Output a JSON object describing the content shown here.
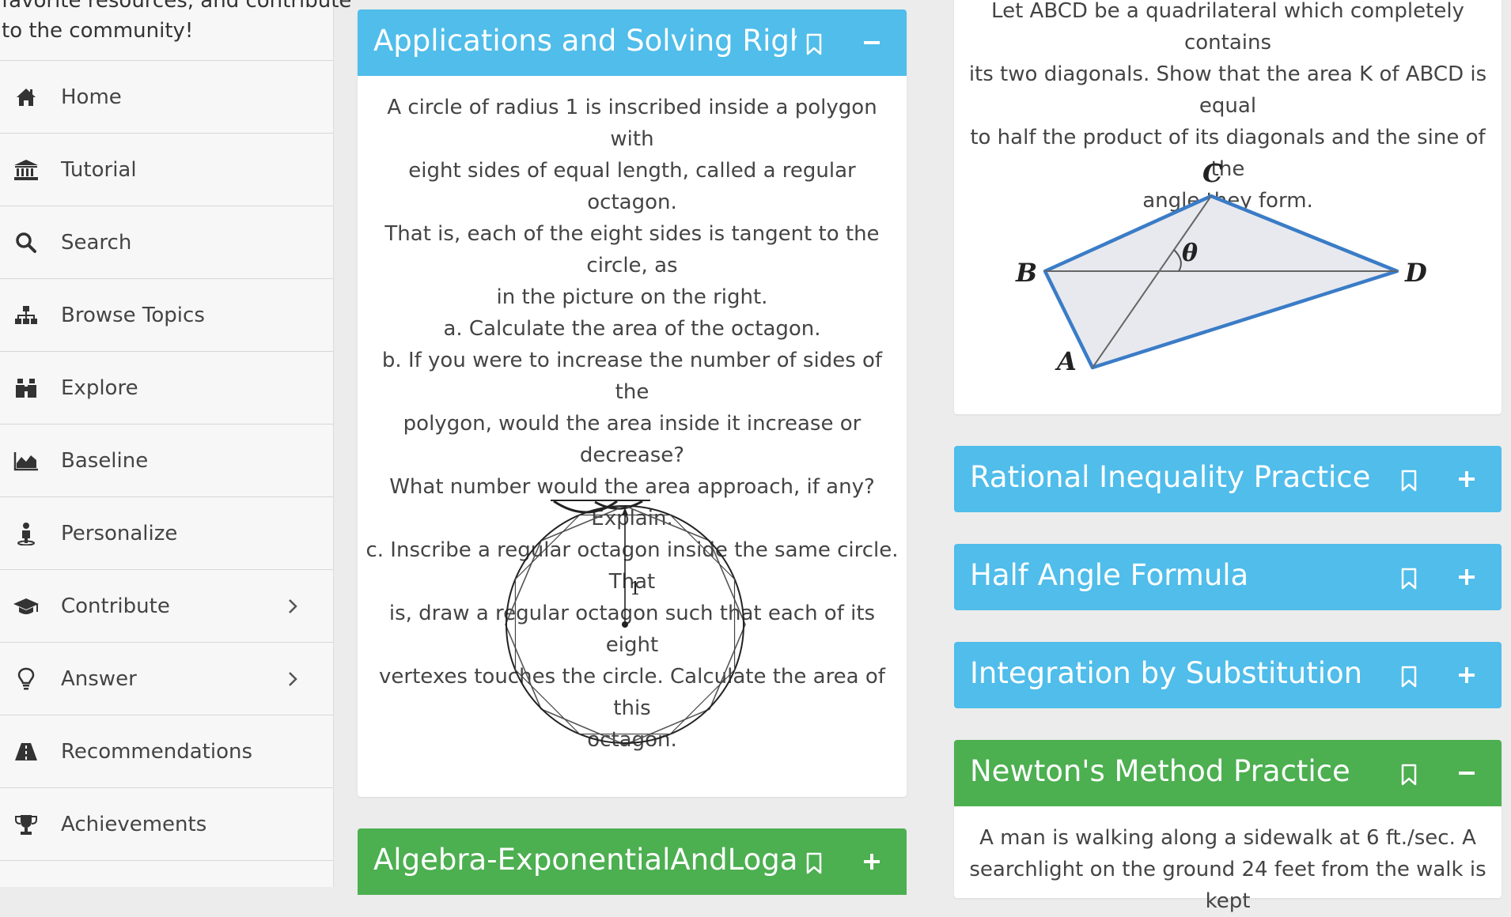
{
  "sidebar": {
    "intro_line1": "favorite resources, and contribute",
    "intro_line2": "to the community!",
    "items": [
      {
        "label": "Home",
        "icon": "home-icon"
      },
      {
        "label": "Tutorial",
        "icon": "institution-icon"
      },
      {
        "label": "Search",
        "icon": "search-icon"
      },
      {
        "label": "Browse Topics",
        "icon": "sitemap-icon"
      },
      {
        "label": "Explore",
        "icon": "binoculars-icon"
      },
      {
        "label": "Baseline",
        "icon": "area-chart-icon"
      },
      {
        "label": "Personalize",
        "icon": "person-icon"
      },
      {
        "label": "Contribute",
        "icon": "graduation-cap-icon",
        "has_submenu": true
      },
      {
        "label": "Answer",
        "icon": "lightbulb-icon",
        "has_submenu": true
      },
      {
        "label": "Recommendations",
        "icon": "road-icon"
      },
      {
        "label": "Achievements",
        "icon": "trophy-icon"
      }
    ]
  },
  "colors": {
    "blue_header": "#50bdea",
    "green_header": "#4caf50",
    "sidebar_bg": "#f7f7f7",
    "page_bg": "#ececec"
  },
  "cards": {
    "applications": {
      "title": "Applications and Solving Right Triangles",
      "lines": [
        "A circle of radius 1 is inscribed inside a polygon with",
        "eight sides of equal length, called a regular octagon.",
        "That is, each of the eight sides is tangent to the circle, as",
        "in the picture on the right.",
        "a. Calculate the area of the octagon.",
        "b. If you were to increase the number of sides of the",
        "polygon, would the area inside it increase or decrease?",
        "What number would the area approach, if any? Explain.",
        "c. Inscribe a regular octagon inside the same circle. That",
        "is, draw a regular octagon such that each of its eight",
        "vertexes touches the circle. Calculate the area of this",
        "octagon."
      ],
      "figure_radius_label": "1",
      "state": "expanded"
    },
    "algebra": {
      "title": "Algebra-ExponentialAndLogarithmicFunctions",
      "state": "collapsed"
    },
    "quadrilateral": {
      "lines": [
        "Let ABCD be a quadrilateral which completely contains",
        "its two diagonals. Show that the area K of ABCD is equal",
        "to half the product of its diagonals and the sine of the",
        "angle they form."
      ],
      "labels": {
        "a": "A",
        "b": "B",
        "c": "C",
        "d": "D",
        "theta": "θ"
      }
    },
    "rational": {
      "title": "Rational Inequality Practice",
      "state": "collapsed"
    },
    "half_angle": {
      "title": "Half Angle Formula",
      "state": "collapsed"
    },
    "integration": {
      "title": "Integration by Substitution",
      "state": "collapsed"
    },
    "newton": {
      "title": "Newton's Method Practice",
      "state": "expanded",
      "lines": [
        "A man is walking along a sidewalk at 6 ft./sec. A",
        "searchlight on the ground 24 feet from the walk is kept"
      ]
    }
  }
}
